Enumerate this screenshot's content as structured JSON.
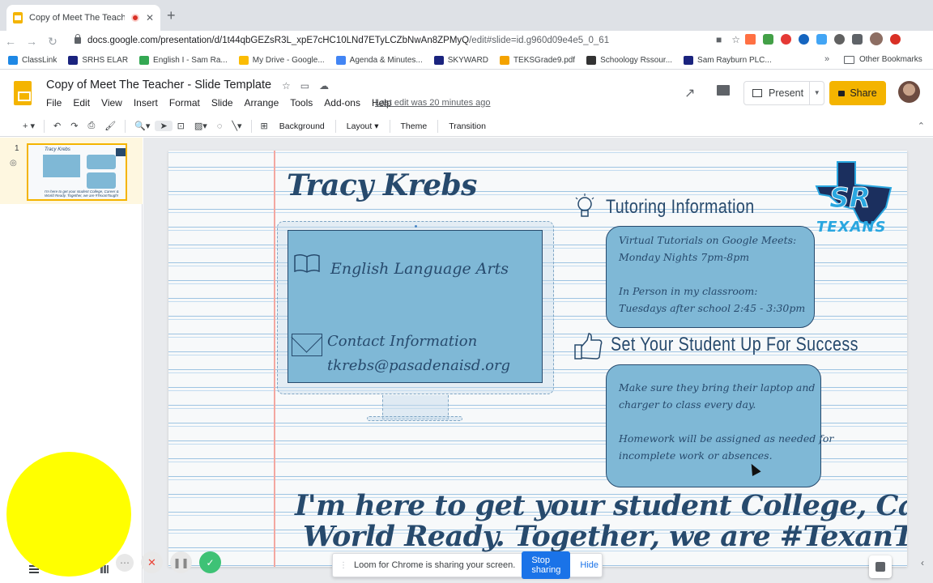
{
  "browser": {
    "tab_title": "Copy of Meet The Teacher",
    "url": "docs.google.com/presentation/d/1t44qbGEZsR3L_xpE7cHC10LNd7ETyLCZbNwAn8ZPMyQ",
    "url_tail": "/edit#slide=id.g960d09e4e5_0_61",
    "bookmarks": [
      {
        "label": "ClassLink",
        "color": "#1e88e5"
      },
      {
        "label": "SRHS ELAR",
        "color": "#1a237e"
      },
      {
        "label": "English I - Sam Ra...",
        "color": "#34a853"
      },
      {
        "label": "My Drive - Google...",
        "color": "#fbbc04"
      },
      {
        "label": "Agenda & Minutes...",
        "color": "#4285f4"
      },
      {
        "label": "SKYWARD",
        "color": "#1a237e"
      },
      {
        "label": "TEKSGrade9.pdf",
        "color": "#f4a300"
      },
      {
        "label": "Schoology Rssour...",
        "color": "#333333"
      },
      {
        "label": "Sam Rayburn PLC...",
        "color": "#1a237e"
      }
    ],
    "bookmarks_more": "»",
    "other_bookmarks": "Other Bookmarks"
  },
  "slides": {
    "doc_title": "Copy of Meet The Teacher - Slide Template",
    "menu": [
      "File",
      "Edit",
      "View",
      "Insert",
      "Format",
      "Slide",
      "Arrange",
      "Tools",
      "Add-ons",
      "Help"
    ],
    "last_edit": "Last edit was 20 minutes ago",
    "present_label": "Present",
    "share_label": "Share",
    "toolbar_text": {
      "background": "Background",
      "layout": "Layout",
      "theme": "Theme",
      "transition": "Transition"
    },
    "slide_number": "1"
  },
  "slide": {
    "teacher_name": "Tracy Krebs",
    "subject": "English Language Arts",
    "contact_label": "Contact Information",
    "contact_email": "tkrebs@pasadenaisd.org",
    "tutoring_heading": "Tutoring Information",
    "tutoring_lines": [
      "Virtual Tutorials on Google Meets:",
      "Monday Nights 7pm-8pm",
      "In Person in my classroom:",
      "Tuesdays after school 2:45 - 3:30pm"
    ],
    "success_heading": "Set Your Student Up For Success",
    "success_lines": [
      "Make sure they bring their laptop and",
      "charger to class every day.",
      "Homework will be assigned as needed for",
      "incomplete work or absences."
    ],
    "logo_text": "TEXANS",
    "footer_lines": [
      "I'm here to get your student College, Career &",
      "World Ready. Together, we are #TexanTough!"
    ]
  },
  "loom": {
    "message": "Loom for Chrome is sharing your screen.",
    "stop_label": "Stop sharing",
    "hide_label": "Hide"
  },
  "colors": {
    "slides_accent": "#f4b400",
    "slide_ink": "#274a6d",
    "box_fill": "#7fb8d6",
    "loom_button": "#1a73e8"
  }
}
